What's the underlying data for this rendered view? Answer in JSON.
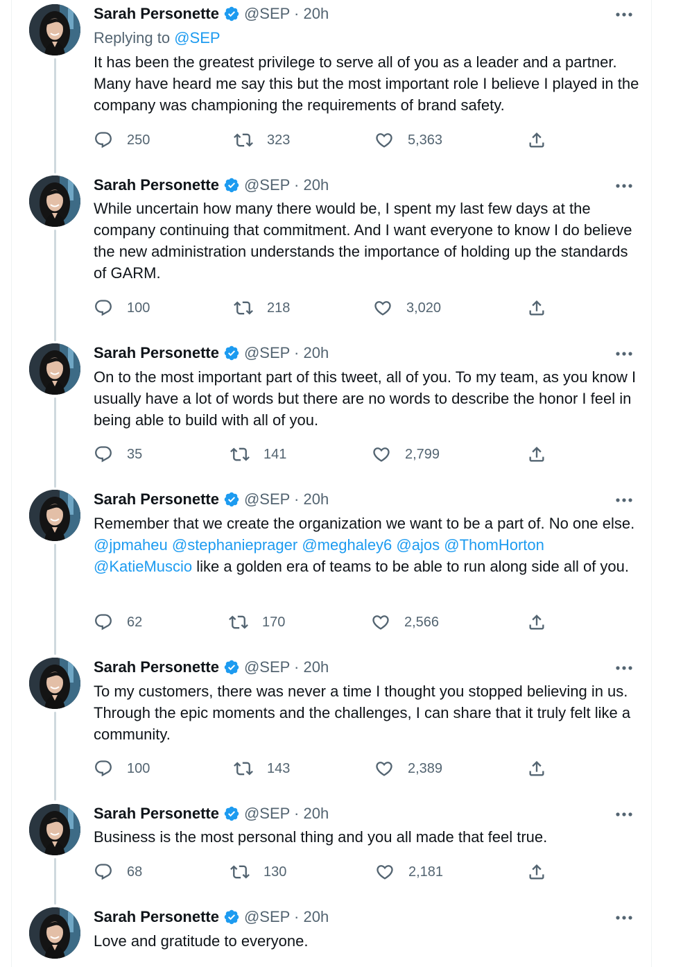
{
  "author": {
    "name": "Sarah Personette",
    "handle_time": "@SEP · 20h"
  },
  "replying": {
    "prefix": "Replying to ",
    "mention": "@SEP"
  },
  "tweets": [
    {
      "paragraph": "It has been the greatest privilege to serve all of you as a leader and a partner.   Many have heard me say this but the most important role I believe I played in the company was championing the requirements of brand safety.",
      "replies": "250",
      "retweets": "323",
      "likes": "5,363"
    },
    {
      "paragraph": "While uncertain how many there would be, I spent my last few days at the company continuing that commitment.   And I want everyone to know I do believe the new administration understands the importance of holding up the standards of GARM.",
      "replies": "100",
      "retweets": "218",
      "likes": "3,020"
    },
    {
      "paragraph": "On to the most important part of this tweet, all of you.  To my team, as you know I usually have a lot of words but there are no words to describe the honor I feel in being able to build with all of you.",
      "replies": "35",
      "retweets": "141",
      "likes": "2,799"
    },
    {
      "text_before": "Remember that we create the organization we want to be a part of.   No one else. ",
      "mentions": [
        "@jpmaheu",
        "@stephanieprager",
        "@meghaley6",
        "@ajos",
        "@ThomHorton",
        "@KatieMuscio"
      ],
      "text_after": " like a golden era of teams to be able to run along side all of you.",
      "replies": "62",
      "retweets": "170",
      "likes": "2,566"
    },
    {
      "paragraph": "To my customers, there was never a time I thought you stopped believing in us. Through the epic moments and the challenges, I can share that it truly felt like a community.",
      "replies": "100",
      "retweets": "143",
      "likes": "2,389"
    },
    {
      "paragraph": "Business is the most personal thing and you all made that feel true.",
      "replies": "68",
      "retweets": "130",
      "likes": "2,181"
    },
    {
      "paragraph": "Love and gratitude to everyone."
    }
  ],
  "icons": {
    "reply": "reply-icon",
    "retweet": "retweet-icon",
    "like": "heart-icon",
    "share": "share-icon",
    "verified": "verified-badge-icon",
    "more": "more-icon"
  },
  "colors": {
    "link": "#1d9bf0",
    "secondary_text": "#536471",
    "verified": "#1d9bf0",
    "thread_line": "#cfd9de"
  }
}
